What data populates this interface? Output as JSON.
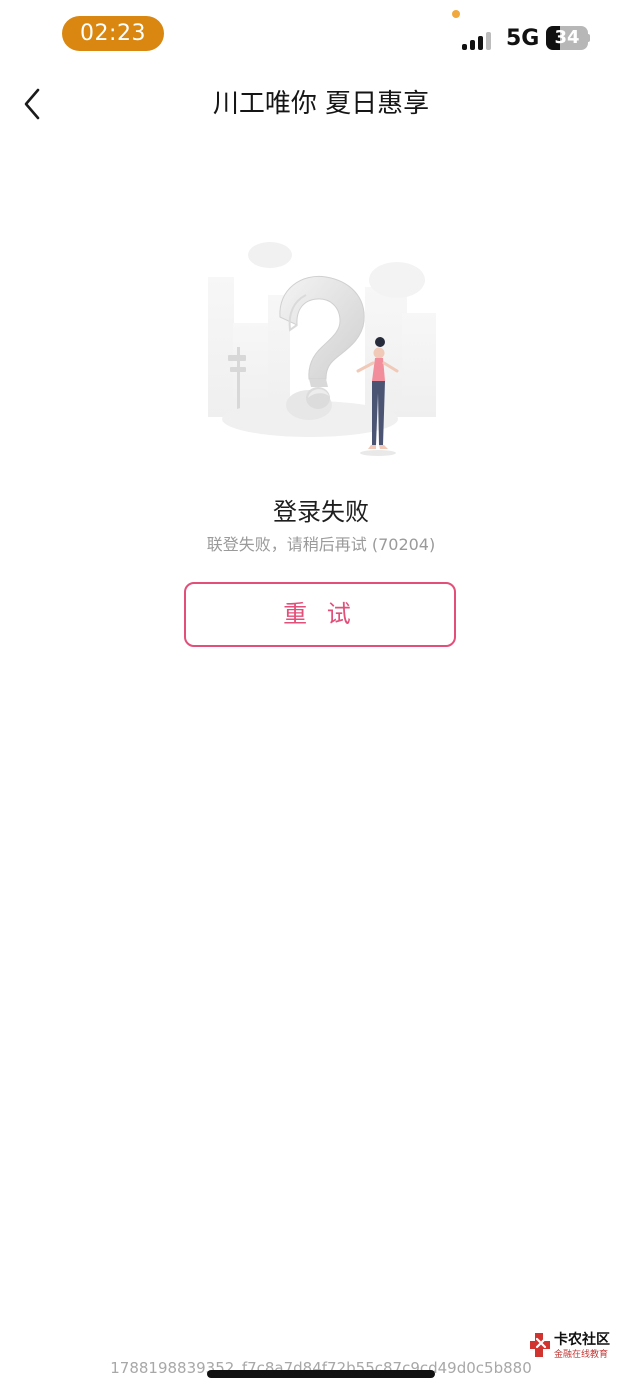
{
  "status_bar": {
    "time": "02:23",
    "network": "5G",
    "battery": {
      "level": 34,
      "label": "34"
    }
  },
  "header": {
    "title": "川工唯你 夏日惠享",
    "back_icon": "chevron-left-icon"
  },
  "error_page": {
    "title": "登录失败",
    "subtitle": "联登失败，请稍后再试 (70204)",
    "retry_label": "重 试",
    "illustration": "question-mark-person-illustration",
    "accent_color": "#e24f79"
  },
  "footer": {
    "request_id": "1788198839352_f7c8a7d84f72b55c87c9cd49d0c5b880"
  },
  "watermark": {
    "title": "卡农社区",
    "subtitle": "金融在线教育"
  },
  "colors": {
    "time_pill": "#d98710",
    "retry_border": "#e24f79",
    "secondary_text": "#9a9a9a"
  }
}
